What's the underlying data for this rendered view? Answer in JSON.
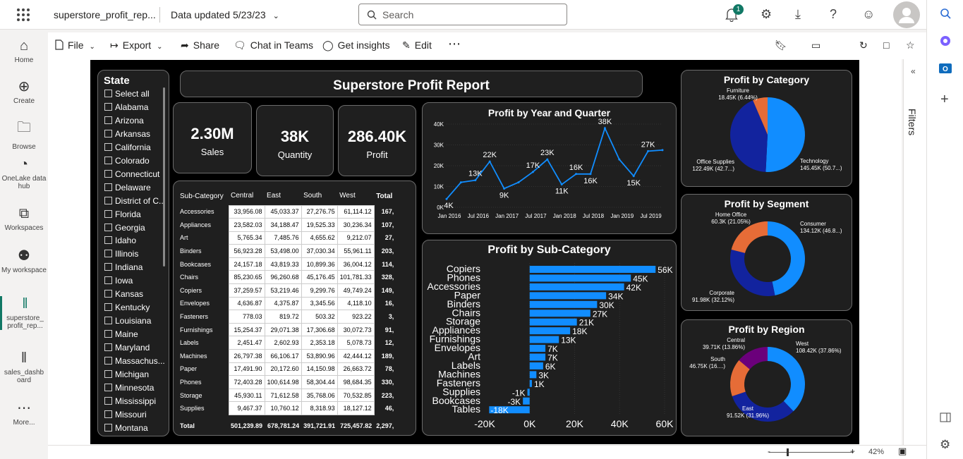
{
  "topbar": {
    "report_name": "superstore_profit_rep...",
    "data_updated": "Data updated 5/23/23",
    "search_placeholder": "Search",
    "notif_count": "1"
  },
  "leftnav": [
    {
      "label": "Home",
      "icon": "home-icon"
    },
    {
      "label": "Create",
      "icon": "plus-circle-icon"
    },
    {
      "label": "Browse",
      "icon": "folder-icon"
    },
    {
      "label": "OneLake data hub",
      "icon": "onelake-icon"
    },
    {
      "label": "Workspaces",
      "icon": "workspaces-icon"
    },
    {
      "label": "My workspace",
      "icon": "people-icon"
    },
    {
      "label": "superstore_ profit_rep...",
      "icon": "report-icon"
    },
    {
      "label": "sales_dashb oard",
      "icon": "report-icon"
    },
    {
      "label": "More...",
      "icon": "more-icon"
    }
  ],
  "actionbar": {
    "file": "File",
    "export": "Export",
    "share": "Share",
    "chat": "Chat in Teams",
    "insights": "Get insights",
    "edit": "Edit"
  },
  "filters_label": "Filters",
  "zoom": "42%",
  "report": {
    "title": "Superstore Profit Report",
    "slicer": {
      "title": "State",
      "items": [
        "Select all",
        "Alabama",
        "Arizona",
        "Arkansas",
        "California",
        "Colorado",
        "Connecticut",
        "Delaware",
        "District of C...",
        "Florida",
        "Georgia",
        "Idaho",
        "Illinois",
        "Indiana",
        "Iowa",
        "Kansas",
        "Kentucky",
        "Louisiana",
        "Maine",
        "Maryland",
        "Massachus...",
        "Michigan",
        "Minnesota",
        "Mississippi",
        "Missouri",
        "Montana"
      ]
    },
    "kpis": [
      {
        "value": "2.30M",
        "label": "Sales"
      },
      {
        "value": "38K",
        "label": "Quantity"
      },
      {
        "value": "286.40K",
        "label": "Profit"
      }
    ],
    "matrix": {
      "headers": [
        "Sub-Category",
        "Central",
        "East",
        "South",
        "West",
        "Total"
      ],
      "rows": [
        [
          "Accessories",
          "33,956.08",
          "45,033.37",
          "27,276.75",
          "61,114.12",
          "167,"
        ],
        [
          "Appliances",
          "23,582.03",
          "34,188.47",
          "19,525.33",
          "30,236.34",
          "107,"
        ],
        [
          "Art",
          "5,765.34",
          "7,485.76",
          "4,655.62",
          "9,212.07",
          "27,"
        ],
        [
          "Binders",
          "56,923.28",
          "53,498.00",
          "37,030.34",
          "55,961.11",
          "203,"
        ],
        [
          "Bookcases",
          "24,157.18",
          "43,819.33",
          "10,899.36",
          "36,004.12",
          "114,"
        ],
        [
          "Chairs",
          "85,230.65",
          "96,260.68",
          "45,176.45",
          "101,781.33",
          "328,"
        ],
        [
          "Copiers",
          "37,259.57",
          "53,219.46",
          "9,299.76",
          "49,749.24",
          "149,"
        ],
        [
          "Envelopes",
          "4,636.87",
          "4,375.87",
          "3,345.56",
          "4,118.10",
          "16,"
        ],
        [
          "Fasteners",
          "778.03",
          "819.72",
          "503.32",
          "923.22",
          "3,"
        ],
        [
          "Furnishings",
          "15,254.37",
          "29,071.38",
          "17,306.68",
          "30,072.73",
          "91,"
        ],
        [
          "Labels",
          "2,451.47",
          "2,602.93",
          "2,353.18",
          "5,078.73",
          "12,"
        ],
        [
          "Machines",
          "26,797.38",
          "66,106.17",
          "53,890.96",
          "42,444.12",
          "189,"
        ],
        [
          "Paper",
          "17,491.90",
          "20,172.60",
          "14,150.98",
          "26,663.72",
          "78,"
        ],
        [
          "Phones",
          "72,403.28",
          "100,614.98",
          "58,304.44",
          "98,684.35",
          "330,"
        ],
        [
          "Storage",
          "45,930.11",
          "71,612.58",
          "35,768.06",
          "70,532.85",
          "223,"
        ],
        [
          "Supplies",
          "9,467.37",
          "10,760.12",
          "8,318.93",
          "18,127.12",
          "46,"
        ]
      ],
      "total": [
        "Total",
        "501,239.89",
        "678,781.24",
        "391,721.91",
        "725,457.82",
        "2,297,"
      ]
    },
    "colors": {
      "blue": "#118dff",
      "darkblue": "#12239e",
      "orange": "#e66c37",
      "purple": "#6b007b",
      "bg": "#000000",
      "panel": "#1f1f1f"
    }
  },
  "chart_data": [
    {
      "type": "line",
      "title": "Profit by Year and Quarter",
      "x": [
        "Jan 2016",
        "Apr 2016",
        "Jul 2016",
        "Oct 2016",
        "Jan 2017",
        "Apr 2017",
        "Jul 2017",
        "Oct 2017",
        "Jan 2018",
        "Apr 2018",
        "Jul 2018",
        "Oct 2018",
        "Jan 2019",
        "Apr 2019",
        "Jul 2019",
        "Oct 2019"
      ],
      "values": [
        4,
        12,
        13,
        22,
        9,
        12,
        17,
        23,
        11,
        16,
        16,
        38,
        23,
        15,
        27,
        27.5
      ],
      "labels": [
        "4K",
        "",
        "13K",
        "22K",
        "9K",
        "",
        "17K",
        "23K",
        "11K",
        "16K",
        "16K",
        "38K",
        "",
        "15K",
        "27K",
        ""
      ],
      "xticks": [
        "Jan 2016",
        "Jul 2016",
        "Jan 2017",
        "Jul 2017",
        "Jan 2018",
        "Jul 2018",
        "Jan 2019",
        "Jul 2019"
      ],
      "yticks": [
        "0K",
        "10K",
        "20K",
        "30K",
        "40K"
      ],
      "ylim": [
        0,
        40
      ]
    },
    {
      "type": "bar",
      "title": "Profit by Sub-Category",
      "orientation": "horizontal",
      "categories": [
        "Copiers",
        "Phones",
        "Accessories",
        "Paper",
        "Binders",
        "Chairs",
        "Storage",
        "Appliances",
        "Furnishings",
        "Envelopes",
        "Art",
        "Labels",
        "Machines",
        "Fasteners",
        "Supplies",
        "Bookcases",
        "Tables"
      ],
      "values": [
        56,
        45,
        42,
        34,
        30,
        27,
        21,
        18,
        13,
        7,
        7,
        6,
        3,
        1,
        -1,
        -3,
        -18
      ],
      "labels": [
        "56K",
        "45K",
        "42K",
        "34K",
        "30K",
        "27K",
        "21K",
        "18K",
        "13K",
        "7K",
        "7K",
        "6K",
        "3K",
        "1K",
        "-1K",
        "-3K",
        "-18K"
      ],
      "xticks": [
        "-20K",
        "0K",
        "20K",
        "40K",
        "60K"
      ],
      "xlim": [
        -20,
        60
      ]
    },
    {
      "type": "pie",
      "title": "Profit by Category",
      "slices": [
        {
          "label": "Technology",
          "value": 145.45,
          "text": "Technology 145.45K (50.7...)",
          "color": "#118dff"
        },
        {
          "label": "Office Supplies",
          "value": 122.49,
          "text": "Office Supplies 122.49K (42.7...)",
          "color": "#12239e"
        },
        {
          "label": "Furniture",
          "value": 18.45,
          "text": "Furniture 18.45K (6.44%)",
          "color": "#e66c37"
        }
      ]
    },
    {
      "type": "pie",
      "donut": true,
      "title": "Profit by Segment",
      "slices": [
        {
          "label": "Consumer",
          "value": 134.12,
          "text": "Consumer 134.12K (46.8...)",
          "color": "#118dff"
        },
        {
          "label": "Corporate",
          "value": 91.98,
          "text": "Corporate 91.98K (32.12%)",
          "color": "#12239e"
        },
        {
          "label": "Home Office",
          "value": 60.3,
          "text": "Home Office 60.3K (21.05%)",
          "color": "#e66c37"
        }
      ]
    },
    {
      "type": "pie",
      "donut": true,
      "title": "Profit by Region",
      "slices": [
        {
          "label": "West",
          "value": 108.42,
          "text": "West 108.42K (37.86%)",
          "color": "#118dff"
        },
        {
          "label": "East",
          "value": 91.52,
          "text": "East 91.52K (31.96%)",
          "color": "#12239e"
        },
        {
          "label": "South",
          "value": 46.75,
          "text": "South 46.75K (16....)",
          "color": "#e66c37"
        },
        {
          "label": "Central",
          "value": 39.71,
          "text": "Central 39.71K (13.86%)",
          "color": "#6b007b"
        }
      ]
    }
  ]
}
